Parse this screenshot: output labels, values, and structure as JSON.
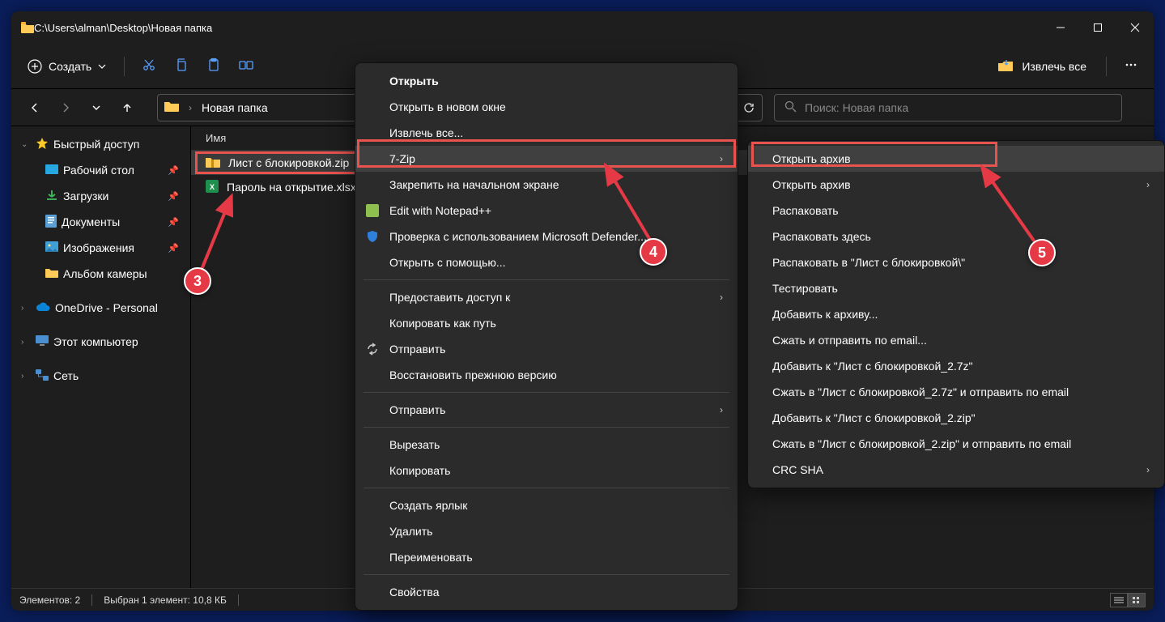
{
  "title_path": "C:\\Users\\alman\\Desktop\\Новая папка",
  "toolbar": {
    "create_label": "Создать",
    "extract_all_label": "Извлечь все"
  },
  "breadcrumb": {
    "folder_label": "Новая папка"
  },
  "search": {
    "placeholder": "Поиск: Новая папка"
  },
  "sidebar": {
    "quick_access": "Быстрый доступ",
    "desktop": "Рабочий стол",
    "downloads": "Загрузки",
    "documents": "Документы",
    "pictures": "Изображения",
    "camera_roll": "Альбом камеры",
    "onedrive": "OneDrive - Personal",
    "this_pc": "Этот компьютер",
    "network": "Сеть"
  },
  "columns": {
    "name": "Имя"
  },
  "files": [
    {
      "name": "Лист с блокировкой.zip",
      "selected": true,
      "icon": "zip"
    },
    {
      "name": "Пароль на открытие.xlsx",
      "selected": false,
      "icon": "xlsx"
    }
  ],
  "context_menu": {
    "open": "Открыть",
    "open_new_window": "Открыть в новом окне",
    "extract_all": "Извлечь все...",
    "seven_zip": "7-Zip",
    "pin_start": "Закрепить на начальном экране",
    "edit_npp": "Edit with Notepad++",
    "defender": "Проверка с использованием Microsoft Defender...",
    "open_with": "Открыть с помощью...",
    "give_access": "Предоставить доступ к",
    "copy_as_path": "Копировать как путь",
    "send_to": "Отправить",
    "restore_prev": "Восстановить прежнюю версию",
    "send_to2": "Отправить",
    "cut": "Вырезать",
    "copy": "Копировать",
    "create_shortcut": "Создать ярлык",
    "delete": "Удалить",
    "rename": "Переименовать",
    "properties": "Свойства"
  },
  "submenu_7zip": {
    "open_archive": "Открыть архив",
    "open_archive2": "Открыть архив",
    "unpack": "Распаковать",
    "unpack_here": "Распаковать здесь",
    "unpack_to": "Распаковать в \"Лист с блокировкой\\\"",
    "test": "Тестировать",
    "add_to_archive": "Добавить к архиву...",
    "compress_email": "Сжать и отправить по email...",
    "add_7z": "Добавить к \"Лист с блокировкой_2.7z\"",
    "compress_7z_email": "Сжать в \"Лист с блокировкой_2.7z\" и отправить по email",
    "add_zip": "Добавить к \"Лист с блокировкой_2.zip\"",
    "compress_zip_email": "Сжать в \"Лист с блокировкой_2.zip\" и отправить по email",
    "crc_sha": "CRC SHA"
  },
  "statusbar": {
    "items_count": "Элементов: 2",
    "selected": "Выбран 1 элемент: 10,8 КБ"
  },
  "annotations": {
    "a3": "3",
    "a4": "4",
    "a5": "5"
  }
}
